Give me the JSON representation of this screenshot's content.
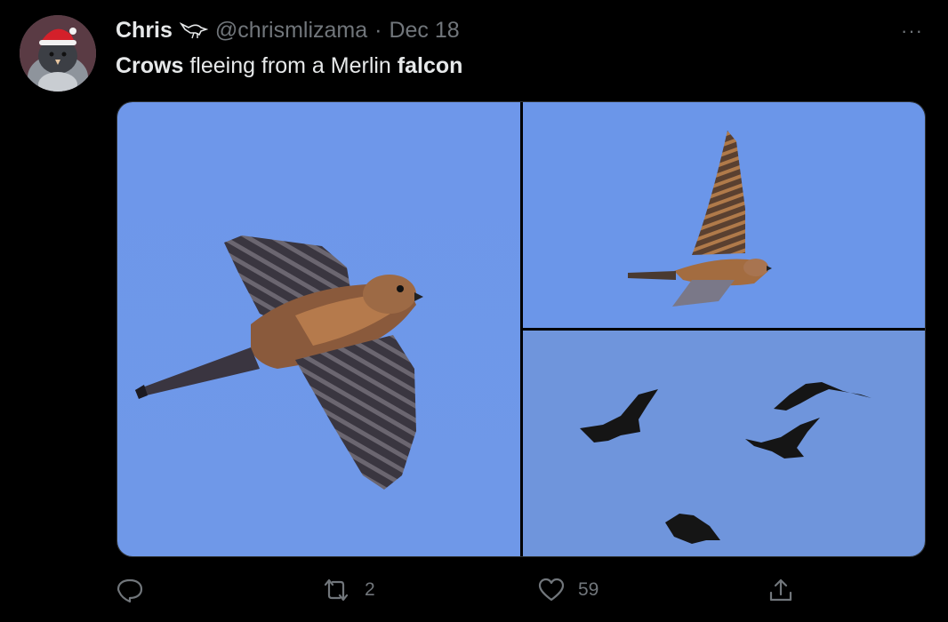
{
  "tweet": {
    "author": {
      "name": "Chris",
      "handle": "@chrismlizama",
      "separator": "·",
      "date": "Dec 18"
    },
    "text": {
      "part1_bold": "Crows",
      "part2": " fleeing from a Merlin ",
      "part3_bold": "falcon"
    },
    "more_label": "···",
    "media": [
      {
        "subject": "merlin falcon in flight close-up"
      },
      {
        "subject": "merlin falcon in flight wings up"
      },
      {
        "subject": "four crows in flight"
      }
    ],
    "actions": {
      "reply_count": "",
      "retweet_count": "2",
      "like_count": "59",
      "share_count": ""
    }
  },
  "colors": {
    "background": "#000000",
    "text_primary": "#e7e9ea",
    "text_secondary": "#71767b",
    "sky": "#6f98e8"
  }
}
